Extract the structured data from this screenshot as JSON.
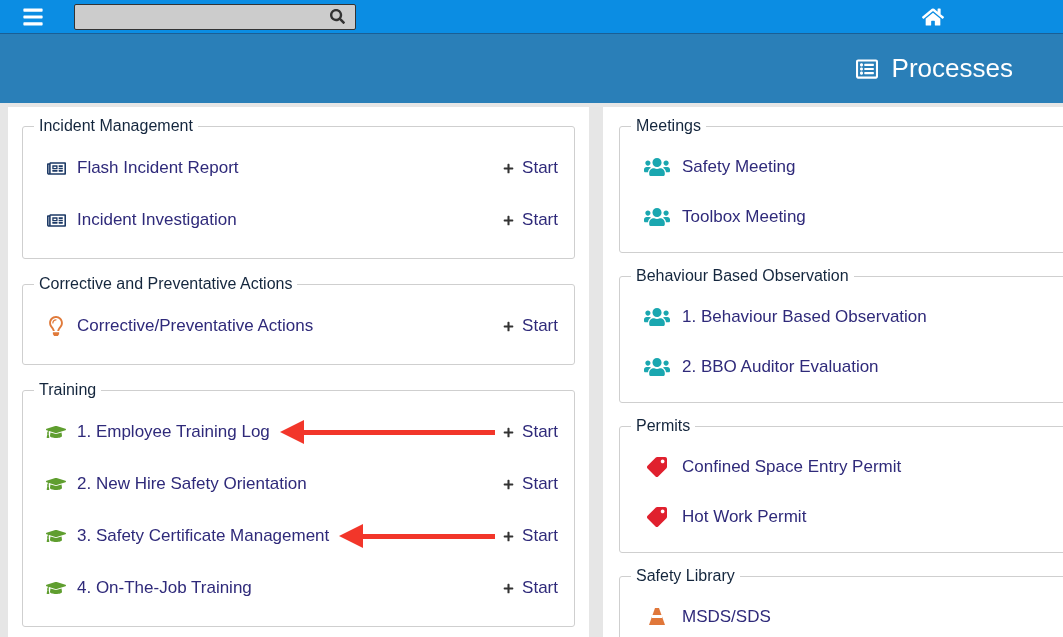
{
  "header": {
    "title": "Processes"
  },
  "columns": [
    {
      "sections": [
        {
          "title": "Incident Management",
          "items": [
            {
              "label": "Flash Incident Report",
              "kind": "form",
              "action": "Start",
              "marked": false
            },
            {
              "label": "Incident Investigation",
              "kind": "form",
              "action": "Start",
              "marked": false
            }
          ]
        },
        {
          "title": "Corrective and Preventative Actions",
          "items": [
            {
              "label": "Corrective/Preventative Actions",
              "kind": "bulb",
              "action": "Start",
              "marked": false
            }
          ]
        },
        {
          "title": "Training",
          "items": [
            {
              "label": "1. Employee Training Log",
              "kind": "training",
              "action": "Start",
              "marked": true
            },
            {
              "label": "2. New Hire Safety Orientation",
              "kind": "training",
              "action": "Start",
              "marked": false
            },
            {
              "label": "3. Safety Certificate Management",
              "kind": "training",
              "action": "Start",
              "marked": true
            },
            {
              "label": "4. On-The-Job Training",
              "kind": "training",
              "action": "Start",
              "marked": false
            }
          ]
        }
      ]
    },
    {
      "sections": [
        {
          "title": "Meetings",
          "items": [
            {
              "label": "Safety Meeting",
              "kind": "meeting"
            },
            {
              "label": "Toolbox Meeting",
              "kind": "meeting"
            }
          ]
        },
        {
          "title": "Behaviour Based Observation",
          "items": [
            {
              "label": "1. Behaviour Based Observation",
              "kind": "meeting"
            },
            {
              "label": "2. BBO Auditor Evaluation",
              "kind": "meeting"
            }
          ]
        },
        {
          "title": "Permits",
          "items": [
            {
              "label": "Confined Space Entry Permit",
              "kind": "permit"
            },
            {
              "label": "Hot Work Permit",
              "kind": "permit"
            }
          ]
        },
        {
          "title": "Safety Library",
          "items": [
            {
              "label": "MSDS/SDS",
              "kind": "library"
            }
          ]
        }
      ]
    }
  ]
}
